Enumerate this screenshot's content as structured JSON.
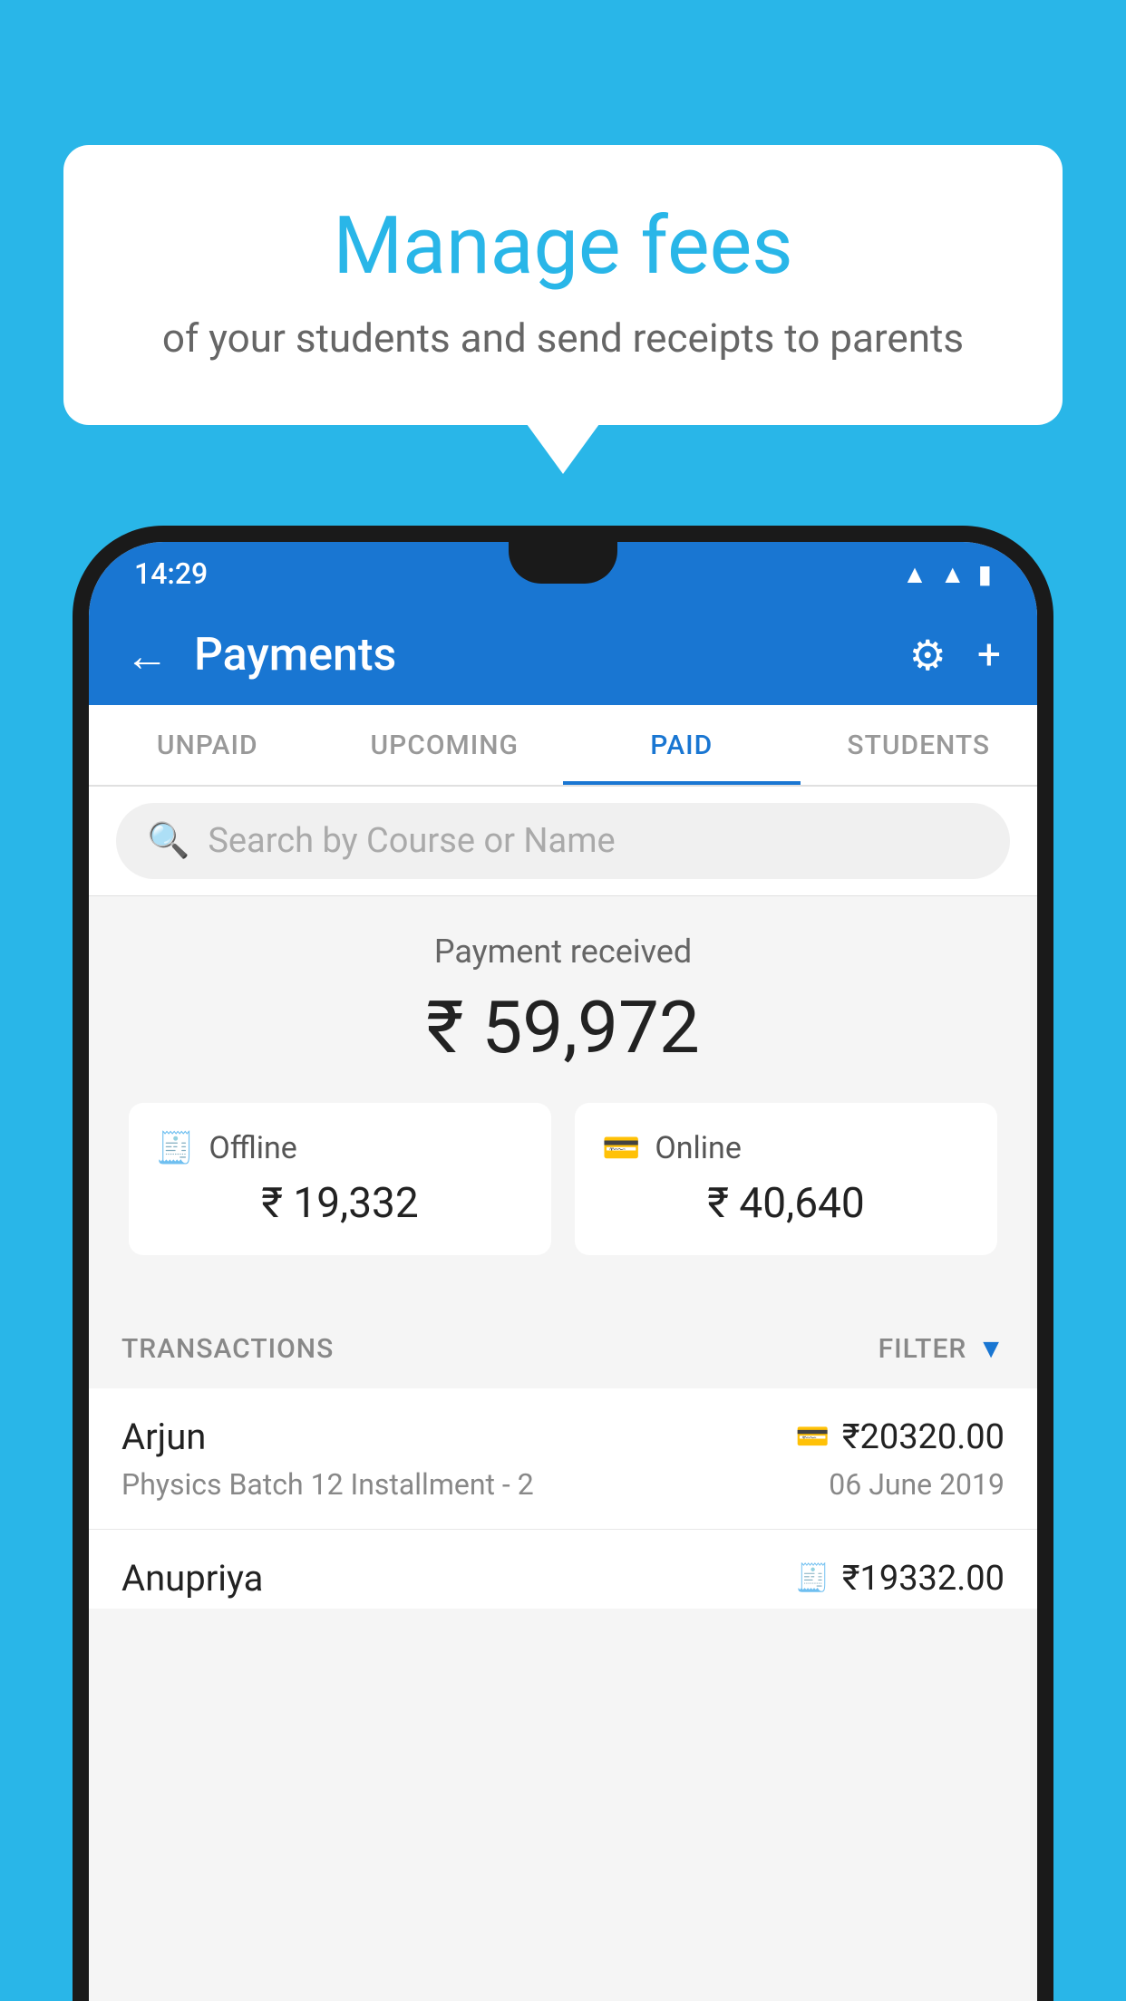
{
  "background_color": "#29b6e8",
  "bubble": {
    "title": "Manage fees",
    "subtitle": "of your students and send receipts to parents"
  },
  "status_bar": {
    "time": "14:29",
    "icons": [
      "wifi",
      "signal",
      "battery"
    ]
  },
  "app_bar": {
    "title": "Payments",
    "back_label": "←",
    "settings_label": "⚙",
    "add_label": "+"
  },
  "tabs": [
    {
      "label": "UNPAID",
      "active": false
    },
    {
      "label": "UPCOMING",
      "active": false
    },
    {
      "label": "PAID",
      "active": true
    },
    {
      "label": "STUDENTS",
      "active": false
    }
  ],
  "search": {
    "placeholder": "Search by Course or Name"
  },
  "payment_summary": {
    "label": "Payment received",
    "amount": "₹ 59,972",
    "offline": {
      "icon": "🧾",
      "label": "Offline",
      "amount": "₹ 19,332"
    },
    "online": {
      "icon": "💳",
      "label": "Online",
      "amount": "₹ 40,640"
    }
  },
  "transactions": {
    "header_label": "TRANSACTIONS",
    "filter_label": "FILTER",
    "rows": [
      {
        "name": "Arjun",
        "payment_icon": "💳",
        "amount": "₹20320.00",
        "course": "Physics Batch 12 Installment - 2",
        "date": "06 June 2019"
      },
      {
        "name": "Anupriya",
        "payment_icon": "🧾",
        "amount": "₹19332.00",
        "course": "",
        "date": ""
      }
    ]
  }
}
